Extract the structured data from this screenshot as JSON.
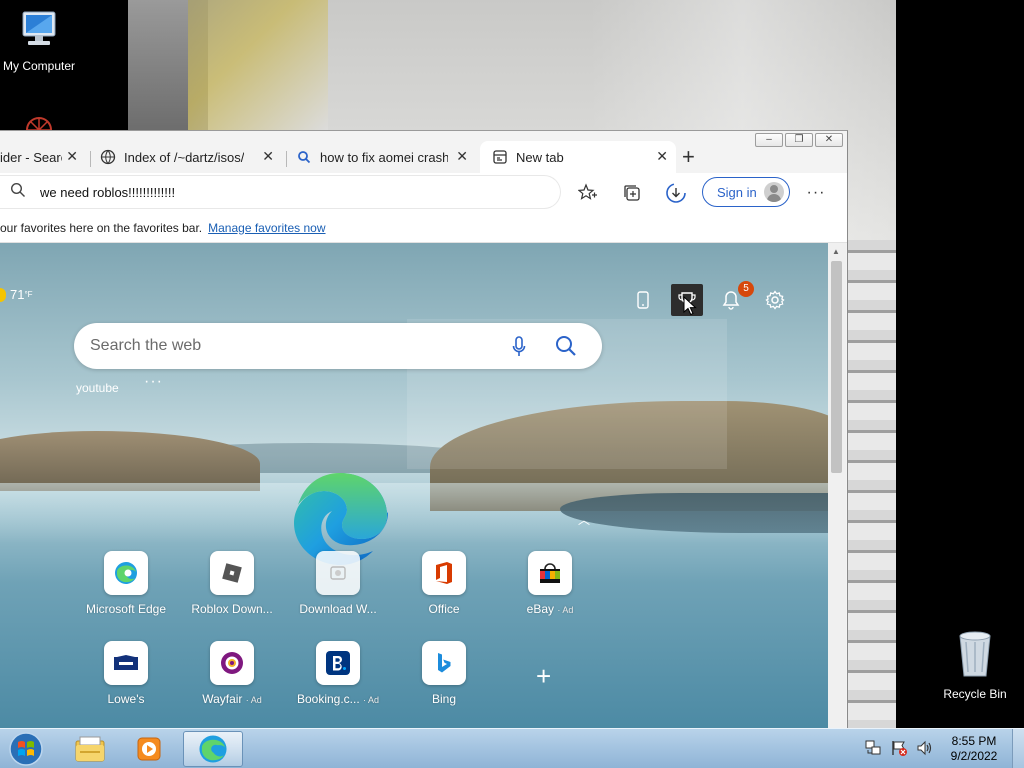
{
  "desktop": {
    "icons": [
      {
        "label": "My Computer",
        "icon": "computer-icon"
      },
      {
        "label": "Recycle Bin",
        "icon": "recycle-bin-icon"
      }
    ]
  },
  "browser": {
    "tabs": [
      {
        "title": "ider - Searc",
        "icon": "page-icon",
        "active": false
      },
      {
        "title": "Index of /~dartz/isos/",
        "icon": "globe-icon",
        "active": false
      },
      {
        "title": "how to fix aomei crash w",
        "icon": "search-icon",
        "active": false
      },
      {
        "title": "New tab",
        "icon": "newtab-icon",
        "active": true
      }
    ],
    "address_text": "we need roblos!!!!!!!!!!!!!",
    "sign_in_label": "Sign in",
    "favbar_text": "our favorites here on the favorites bar.",
    "favbar_link": "Manage favorites now"
  },
  "new_tab_page": {
    "weather": {
      "temp": "71",
      "unit": "°F"
    },
    "notification_count": "5",
    "search_placeholder": "Search the web",
    "quick_link": "youtube",
    "quick_more": "···",
    "tiles": [
      {
        "label": "Microsoft Edge",
        "ad": "",
        "icon": "edge-icon"
      },
      {
        "label": "Roblox Down...",
        "ad": "",
        "icon": "roblox-icon"
      },
      {
        "label": "Download W...",
        "ad": "",
        "icon": "download-icon"
      },
      {
        "label": "Office",
        "ad": "",
        "icon": "office-icon"
      },
      {
        "label": "eBay",
        "ad": "· Ad",
        "icon": "ebay-icon"
      },
      {
        "label": "Lowe's",
        "ad": "",
        "icon": "lowes-icon"
      },
      {
        "label": "Wayfair",
        "ad": "· Ad",
        "icon": "wayfair-icon"
      },
      {
        "label": "Booking.c...",
        "ad": "· Ad",
        "icon": "booking-icon"
      },
      {
        "label": "Bing",
        "ad": "",
        "icon": "bing-icon"
      }
    ]
  },
  "taskbar": {
    "time": "8:55 PM",
    "date": "9/2/2022",
    "pinned": [
      "explorer-icon",
      "media-player-icon",
      "edge-icon"
    ]
  },
  "colors": {
    "accent": "#2b63c9",
    "badge": "#d7480b",
    "taskbar": "#a3c3e0"
  }
}
